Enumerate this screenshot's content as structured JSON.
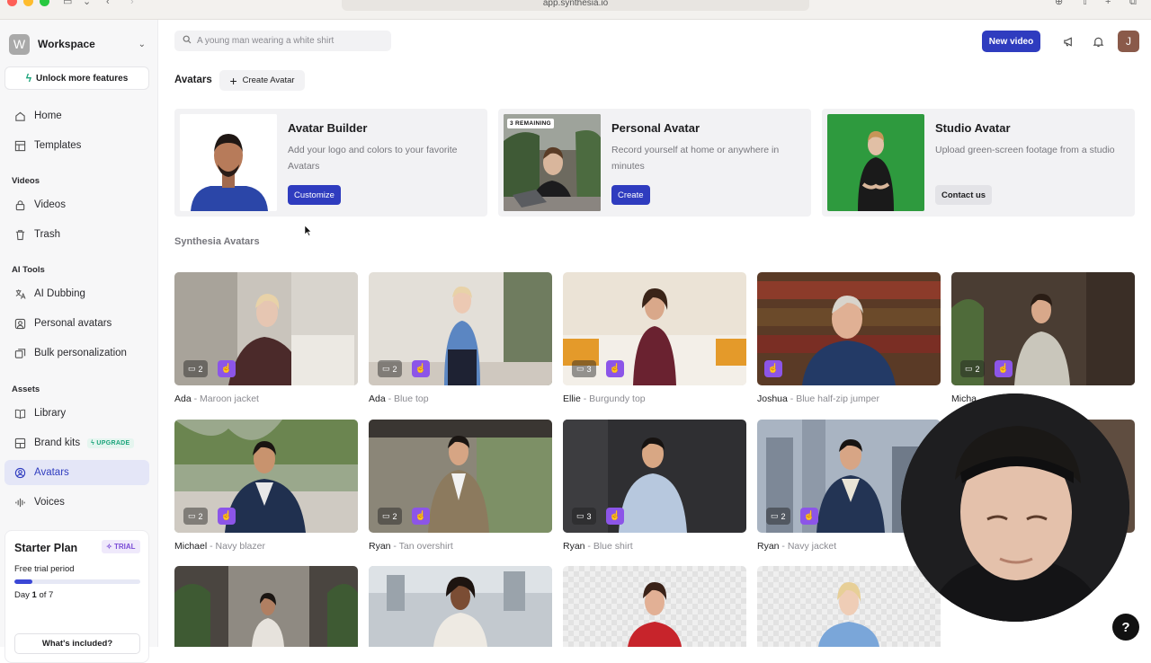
{
  "browser": {
    "url": "app.synthesia.io"
  },
  "sidebar": {
    "workspace_initial": "W",
    "workspace_name": "Workspace",
    "unlock_label": "Unlock more features",
    "home": "Home",
    "templates": "Templates",
    "videos_section": "Videos",
    "videos": "Videos",
    "trash": "Trash",
    "ai_tools_section": "AI Tools",
    "ai_dubbing": "AI Dubbing",
    "personal_avatars": "Personal avatars",
    "bulk_personalization": "Bulk personalization",
    "assets_section": "Assets",
    "library": "Library",
    "brand_kits": "Brand kits",
    "upgrade_badge": "UPGRADE",
    "avatars": "Avatars",
    "voices": "Voices"
  },
  "plan": {
    "title": "Starter Plan",
    "badge": "TRIAL",
    "subtitle": "Free trial period",
    "day_prefix": "Day ",
    "day_current": "1",
    "day_suffix": " of 7",
    "progress": 0.14,
    "button": "What's included?"
  },
  "header": {
    "search_placeholder": "A young man wearing a white shirt",
    "new_video": "New video",
    "user_initial": "J"
  },
  "avatars_page": {
    "title": "Avatars",
    "create_label": "Create Avatar",
    "section_title": "Synthesia Avatars"
  },
  "features": [
    {
      "title": "Avatar Builder",
      "desc": "Add your logo and colors to your favorite Avatars",
      "button": "Customize"
    },
    {
      "title": "Personal Avatar",
      "desc": "Record yourself at home or anywhere in minutes",
      "button": "Create",
      "badge": "3 REMAINING"
    },
    {
      "title": "Studio Avatar",
      "desc": "Upload green-screen footage from a studio",
      "button": "Contact us"
    }
  ],
  "avatars": [
    {
      "name": "Ada",
      "desc": " - Maroon jacket",
      "count": "2"
    },
    {
      "name": "Ada",
      "desc": " - Blue top",
      "count": "2"
    },
    {
      "name": "Ellie",
      "desc": " - Burgundy top",
      "count": "3"
    },
    {
      "name": "Joshua",
      "desc": " - Blue half-zip jumper",
      "count": ""
    },
    {
      "name": "Micha",
      "desc": "",
      "count": "2"
    },
    {
      "name": "Michael",
      "desc": " - Navy blazer",
      "count": "2"
    },
    {
      "name": "Ryan",
      "desc": " - Tan overshirt",
      "count": "2"
    },
    {
      "name": "Ryan",
      "desc": " - Blue shirt",
      "count": "3"
    },
    {
      "name": "Ryan",
      "desc": " - Navy jacket",
      "count": "2"
    }
  ],
  "help": "?"
}
